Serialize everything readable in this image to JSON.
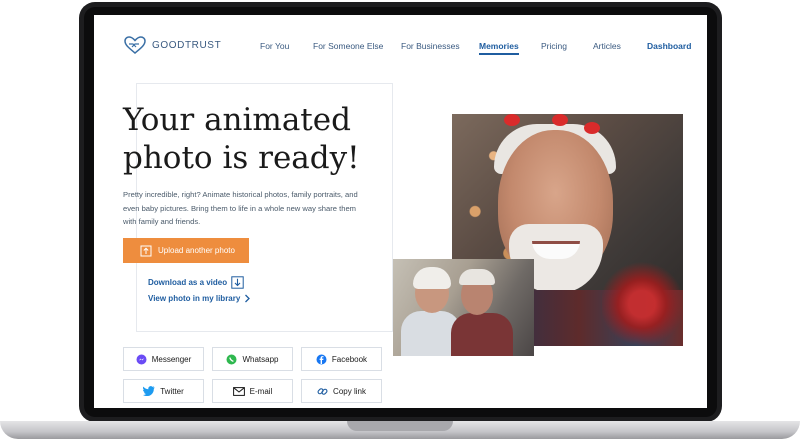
{
  "brand": {
    "name": "GOODTRUST"
  },
  "nav": {
    "items": [
      {
        "label": "For You"
      },
      {
        "label": "For Someone Else"
      },
      {
        "label": "For Businesses"
      },
      {
        "label": "Memories"
      },
      {
        "label": "Pricing"
      },
      {
        "label": "Articles"
      },
      {
        "label": "Dashboard"
      }
    ],
    "active": "Memories"
  },
  "main": {
    "title_line1": "Your animated",
    "title_line2": "photo is ready!",
    "description": "Pretty incredible, right? Animate historical photos, family portraits, and even baby pictures. Bring them to life in a whole new way share them with family and friends.",
    "upload_label": "Upload another photo",
    "download_label": "Download as a video",
    "library_label": "View photo in my library"
  },
  "share": {
    "buttons": [
      {
        "label": "Messenger",
        "icon": "messenger-icon"
      },
      {
        "label": "Whatsapp",
        "icon": "whatsapp-icon"
      },
      {
        "label": "Facebook",
        "icon": "facebook-icon"
      },
      {
        "label": "Twitter",
        "icon": "twitter-icon"
      },
      {
        "label": "E-mail",
        "icon": "email-icon"
      },
      {
        "label": "Copy link",
        "icon": "link-icon"
      }
    ]
  },
  "colors": {
    "accent": "#ee8d3e",
    "link": "#1f5da0",
    "nav_text": "#3a5a80"
  }
}
